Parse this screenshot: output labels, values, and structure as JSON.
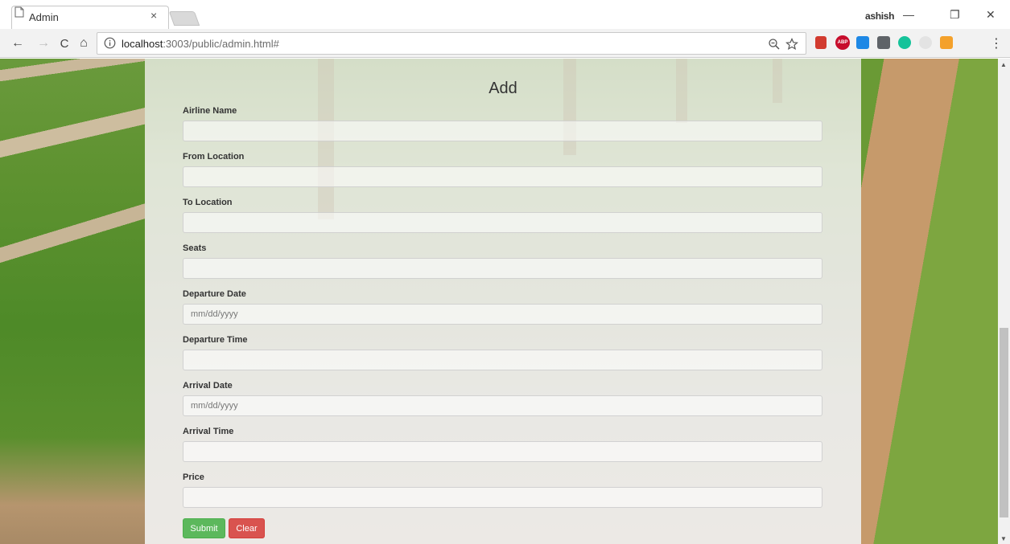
{
  "browser": {
    "tab_title": "Admin",
    "tab_close": "×",
    "profile_name": "ashish",
    "window_controls": {
      "minimize": "—",
      "maximize": "❐",
      "close": "✕"
    },
    "nav": {
      "back": "←",
      "forward": "→",
      "reload": "C",
      "home": "⌂"
    },
    "url_host": "localhost",
    "url_rest": ":3003/public/admin.html#",
    "menu": "⋮",
    "extensions": [
      {
        "name": "bookmark-extension-icon",
        "color": "#d23b2f"
      },
      {
        "name": "adblock-plus-icon",
        "color": "#c70d2c",
        "label": "ABP"
      },
      {
        "name": "tab-extension-icon",
        "color": "#1e88e5"
      },
      {
        "name": "square-extension-icon",
        "color": "#5f6368"
      },
      {
        "name": "grammarly-icon",
        "color": "#15c39a"
      },
      {
        "name": "grey-extension-icon",
        "color": "#cfcfcf"
      },
      {
        "name": "color-extension-icon",
        "color": "#f4a12b"
      }
    ]
  },
  "form": {
    "title": "Add",
    "fields": [
      {
        "label": "Airline Name",
        "placeholder": ""
      },
      {
        "label": "From Location",
        "placeholder": ""
      },
      {
        "label": "To Location",
        "placeholder": ""
      },
      {
        "label": "Seats",
        "placeholder": ""
      },
      {
        "label": "Departure Date",
        "placeholder": "mm/dd/yyyy"
      },
      {
        "label": "Departure Time",
        "placeholder": ""
      },
      {
        "label": "Arrival Date",
        "placeholder": "mm/dd/yyyy"
      },
      {
        "label": "Arrival Time",
        "placeholder": ""
      },
      {
        "label": "Price",
        "placeholder": ""
      }
    ],
    "submit_label": "Submit",
    "clear_label": "Clear"
  },
  "colors": {
    "submit": "#5cb85c",
    "clear": "#d9534f"
  }
}
